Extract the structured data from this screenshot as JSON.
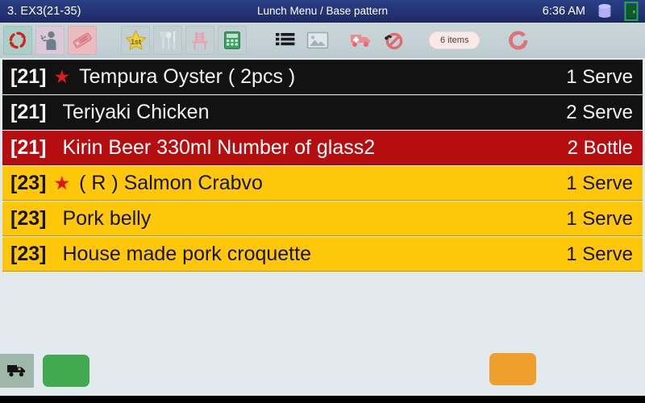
{
  "titlebar": {
    "left_label": "3. EX3(21-35)",
    "center_label": "Lunch Menu / Base pattern",
    "clock": "6:36 AM",
    "database_icon": "database-icon",
    "exit_icon": "exit-door-icon",
    "background_color": "#25357a",
    "text_color": "#ffffff"
  },
  "toolbar": {
    "background_color": "#c4d2d5",
    "items_badge": "6 items",
    "buttons": [
      {
        "name": "refresh-cycle-button",
        "icon": "circular-arrows-icon",
        "tile": "teal"
      },
      {
        "name": "waiter-staff-button",
        "icon": "waiter-icon",
        "tile": "lilac"
      },
      {
        "name": "price-tag-button",
        "icon": "price-tag-icon",
        "tile": "pink"
      },
      {
        "name": "first-place-star-button",
        "icon": "star-first-icon",
        "tile": "grey"
      },
      {
        "name": "cutlery-button",
        "icon": "cutlery-icon",
        "tile": "grey"
      },
      {
        "name": "chair-seat-button",
        "icon": "chair-icon",
        "tile": "grey"
      },
      {
        "name": "calculator-button",
        "icon": "calculator-icon",
        "tile": "grey"
      },
      {
        "name": "list-view-button",
        "icon": "list-icon",
        "tile": "flat"
      },
      {
        "name": "image-view-button",
        "icon": "image-icon",
        "tile": "flat"
      },
      {
        "name": "delivery-truck-button",
        "icon": "truck-icon",
        "tile": "flat"
      },
      {
        "name": "no-entry-button",
        "icon": "prohibited-icon",
        "tile": "flat"
      },
      {
        "name": "reload-button",
        "icon": "refresh-arrow-icon",
        "tile": "flat"
      }
    ]
  },
  "order_list": {
    "rows": [
      {
        "code": "[21]",
        "star": "★",
        "name": "Tempura Oyster ( 2pcs )",
        "qty": "1 Serve",
        "theme": "theme-black"
      },
      {
        "code": "[21]",
        "star": "",
        "name": "Teriyaki Chicken",
        "qty": "2 Serve",
        "theme": "theme-black"
      },
      {
        "code": "[21]",
        "star": "",
        "name": "Kirin Beer 330ml Number of glass2",
        "qty": "2 Bottle",
        "theme": "theme-red"
      },
      {
        "code": "[23]",
        "star": "★",
        "name": "( R ) Salmon Crabvo",
        "qty": "1 Serve",
        "theme": "theme-yellow"
      },
      {
        "code": "[23]",
        "star": "",
        "name": "Pork belly",
        "qty": "1 Serve",
        "theme": "theme-yellow"
      },
      {
        "code": "[23]",
        "star": "",
        "name": "House made pork croquette",
        "qty": "1 Serve",
        "theme": "theme-yellow"
      }
    ],
    "row_colors": {
      "black": "#121212",
      "red": "#b60d10",
      "yellow": "#ffc709",
      "star": "#e01b1b"
    },
    "background_color": "#e2eaee"
  },
  "bottombar": {
    "truck_tile": {
      "name": "delivery-status-button",
      "icon": "truck-icon",
      "background_color": "#9fb7a8"
    },
    "green_button": {
      "name": "confirm-button",
      "label": "",
      "color": "#41a94f"
    },
    "orange_button": {
      "name": "action-button",
      "label": "",
      "color": "#eda02c"
    }
  }
}
